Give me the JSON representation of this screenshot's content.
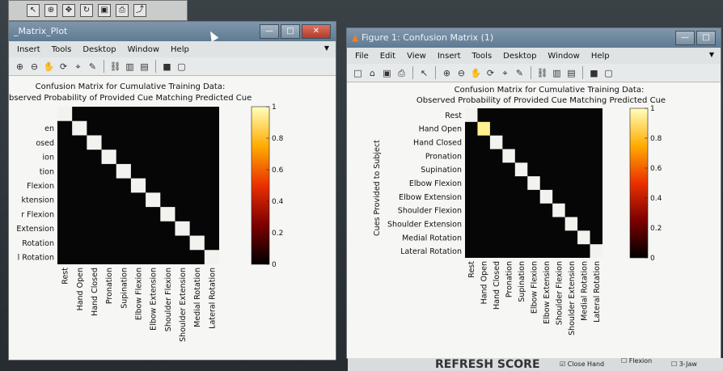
{
  "background_toolbar": {
    "icons": [
      "pointer-icon",
      "zoom-icon",
      "pan-icon",
      "rotate-icon",
      "save-icon",
      "print-icon",
      "link-icon"
    ]
  },
  "left_window": {
    "title": "_Matrix_Plot",
    "menus": [
      "Insert",
      "Tools",
      "Desktop",
      "Window",
      "Help"
    ],
    "chart_title_1": "Confusion Matrix for Cumulative Training Data:",
    "chart_title_2": "bserved Probability of Provided Cue Matching Predicted Cue",
    "y_labels": [
      "en",
      "osed",
      "ion",
      "tion",
      "Flexion",
      "ktension",
      "r Flexion",
      "Extension",
      "Rotation",
      "l Rotation"
    ],
    "x_labels": [
      "Rest",
      "Hand Open",
      "Hand Closed",
      "Pronation",
      "Supination",
      "Elbow Flexion",
      "Elbow Extension",
      "Shoulder Flexion",
      "Shoulder Extension",
      "Medial Rotation",
      "Lateral Rotation"
    ],
    "colorbar_ticks": [
      "1",
      "0.8",
      "0.6",
      "0.4",
      "0.2",
      "0"
    ]
  },
  "right_window": {
    "title": "Figure 1: Confusion Matrix (1)",
    "menus": [
      "File",
      "Edit",
      "View",
      "Insert",
      "Tools",
      "Desktop",
      "Window",
      "Help"
    ],
    "chart_title_1": "Confusion Matrix for Cumulative Training Data:",
    "chart_title_2": "Observed Probability of Provided Cue Matching Predicted Cue",
    "y_axis_label": "Cues Provided to Subject",
    "y_labels": [
      "Rest",
      "Hand Open",
      "Hand Closed",
      "Pronation",
      "Supination",
      "Elbow Flexion",
      "Elbow Extension",
      "Shoulder Flexion",
      "Shoulder Extension",
      "Medial Rotation",
      "Lateral Rotation"
    ],
    "x_labels": [
      "Rest",
      "Hand Open",
      "Hand Closed",
      "Pronation",
      "Supination",
      "Elbow Flexion",
      "Elbow Extension",
      "Shoulder Flexion",
      "Shoulder Extension",
      "Medial Rotation",
      "Lateral Rotation"
    ],
    "colorbar_ticks": [
      "1",
      "0.8",
      "0.6",
      "0.4",
      "0.2",
      "0"
    ]
  },
  "bottom_panel": {
    "refresh_label": "REFRESH SCORE",
    "check_close_hand": "Close Hand",
    "check_flexion": "Flexion",
    "check_3jaw": "3-Jaw"
  },
  "colors": {
    "diag": "#f2f2ee",
    "off": "#060606",
    "hot_top": "#ffff9a",
    "hot_mid": "#ff4a00",
    "hot_low": "#a00000"
  },
  "chart_data": [
    {
      "type": "heatmap",
      "title": "Confusion Matrix for Cumulative Training Data: Observed Probability of Provided Cue Matching Predicted Cue",
      "xlabel": "",
      "ylabel": "",
      "categories": [
        "Rest",
        "Hand Open",
        "Hand Closed",
        "Pronation",
        "Supination",
        "Elbow Flexion",
        "Elbow Extension",
        "Shoulder Flexion",
        "Shoulder Extension",
        "Medial Rotation",
        "Lateral Rotation"
      ],
      "diagonal": [
        1,
        1,
        1,
        1,
        1,
        1,
        1,
        1,
        1,
        1,
        1
      ],
      "off_diagonal": 0,
      "colorbar_range": [
        0,
        1
      ]
    },
    {
      "type": "heatmap",
      "title": "Confusion Matrix for Cumulative Training Data: Observed Probability of Provided Cue Matching Predicted Cue",
      "xlabel": "",
      "ylabel": "Cues Provided to Subject",
      "categories": [
        "Rest",
        "Hand Open",
        "Hand Closed",
        "Pronation",
        "Supination",
        "Elbow Flexion",
        "Elbow Extension",
        "Shoulder Flexion",
        "Shoulder Extension",
        "Medial Rotation",
        "Lateral Rotation"
      ],
      "diagonal": [
        1,
        0.95,
        1,
        1,
        1,
        1,
        1,
        1,
        1,
        1,
        1
      ],
      "off_diagonal": 0,
      "colorbar_range": [
        0,
        1
      ]
    }
  ]
}
